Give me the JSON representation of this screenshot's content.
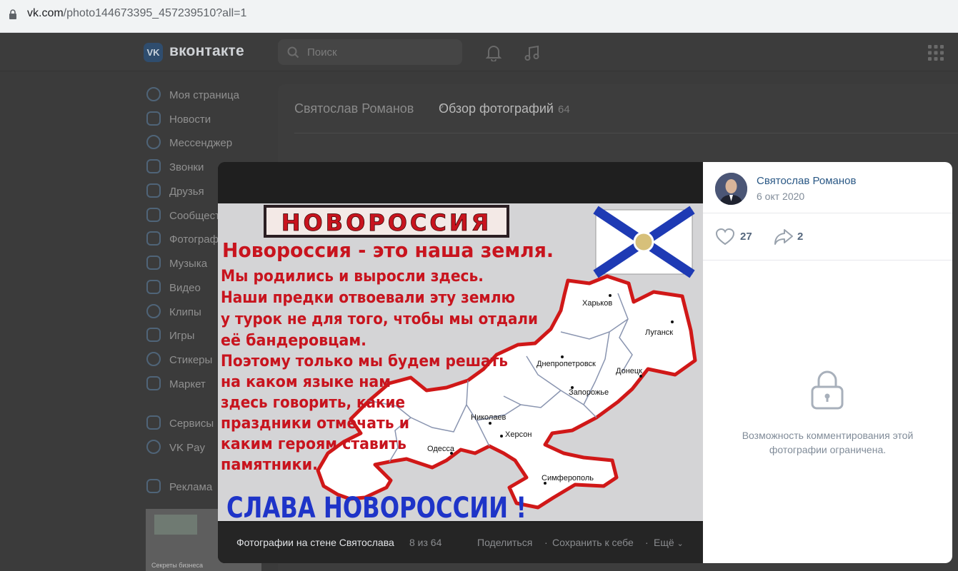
{
  "browser": {
    "url_host": "vk.com",
    "url_path": "/photo144673395_457239510?all=1"
  },
  "header": {
    "logo_text": "вконтакте",
    "logo_mark": "VK",
    "search_placeholder": "Поиск"
  },
  "sidebar": {
    "items": [
      {
        "label": "Моя страница",
        "icon": "user-circle-icon"
      },
      {
        "label": "Новости",
        "icon": "news-icon"
      },
      {
        "label": "Мессенджер",
        "icon": "message-icon"
      },
      {
        "label": "Звонки",
        "icon": "phone-icon"
      },
      {
        "label": "Друзья",
        "icon": "friends-icon"
      },
      {
        "label": "Сообществ",
        "icon": "communities-icon"
      },
      {
        "label": "Фотограф",
        "icon": "photo-icon"
      },
      {
        "label": "Музыка",
        "icon": "music-icon"
      },
      {
        "label": "Видео",
        "icon": "video-icon"
      },
      {
        "label": "Клипы",
        "icon": "clips-icon"
      },
      {
        "label": "Игры",
        "icon": "games-icon"
      },
      {
        "label": "Стикеры",
        "icon": "stickers-icon"
      },
      {
        "label": "Маркет",
        "icon": "market-icon"
      },
      {
        "label": "Сервисы",
        "icon": "services-icon"
      },
      {
        "label": "VK Pay",
        "icon": "vkpay-icon"
      },
      {
        "label": "Реклама",
        "icon": "ads-icon"
      }
    ],
    "thumb_caption": "Секреты бизнеса"
  },
  "breadcrumb": {
    "owner": "Святослав Романов",
    "section": "Обзор фотографий",
    "count": "64"
  },
  "photo": {
    "title": "НОВОРОССИЯ",
    "headline": "Новороссия - это наша земля.",
    "lines": [
      "Мы родились и выросли здесь.",
      "Наши предки отвоевали эту землю",
      "у турок не для того, чтобы мы отдали",
      "её бандеровцам.",
      "Поэтому только мы будем решать",
      "на каком языке нам",
      "здесь говорить, какие",
      "праздники отмечать и",
      "каким героям ставить",
      "памятники."
    ],
    "slogan": "СЛАВА НОВОРОССИИ !",
    "cities": [
      "Харьков",
      "Луганск",
      "Днепропетровск",
      "Донецк",
      "Запорожье",
      "Николаев",
      "Херсон",
      "Одесса",
      "Симферополь"
    ]
  },
  "photo_bar": {
    "album": "Фотографии на стене Святослава",
    "position": "8 из 64",
    "share": "Поделиться",
    "save": "Сохранить к себе",
    "more": "Ещё",
    "dot": "·"
  },
  "panel": {
    "author": "Святослав Романов",
    "date": "6 окт 2020",
    "likes": "27",
    "shares": "2",
    "comments_closed_1": "Возможность комментирования этой",
    "comments_closed_2": "фотографии ограничена."
  },
  "colors": {
    "link": "#2a5885",
    "poster_red": "#c8141e",
    "poster_blue": "#1e34c8"
  }
}
